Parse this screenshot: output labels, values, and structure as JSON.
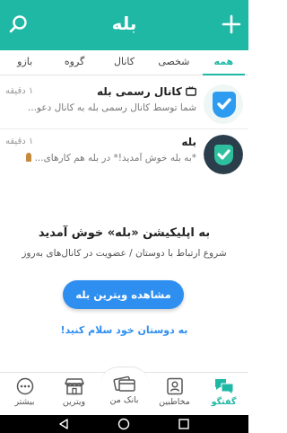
{
  "header": {
    "title": "بله",
    "search_icon": "search-icon",
    "add_icon": "plus-icon",
    "color": "#1fb8a5"
  },
  "tabs": [
    {
      "label": "همه",
      "active": true
    },
    {
      "label": "شخصی",
      "active": false
    },
    {
      "label": "کانال",
      "active": false
    },
    {
      "label": "گروه",
      "active": false
    },
    {
      "label": "بازو",
      "active": false
    }
  ],
  "chats": [
    {
      "name": "کانال رسمی بله",
      "time": "۱ دقیقه",
      "message": "شما توسط کانال رسمی بله به کانال دعو...",
      "icon": "tv-icon"
    },
    {
      "name": "بله",
      "time": "۱ دقیقه",
      "message": "*به بله خوش آمدید!* در بله هم کارهای..."
    }
  ],
  "welcome": {
    "title": "به اپلیکیشن «بله» خوش آمدید",
    "subtitle": "شروع ارتباط با دوستان / عضویت در کانال‌های به‌روز",
    "showcase_button": "مشاهده ویترین بله",
    "hello_link": "به دوستان خود سلام کنید!"
  },
  "bottom_nav": [
    {
      "label": "گفتگو",
      "icon": "chat-bubbles-icon",
      "active": true
    },
    {
      "label": "مخاطبین",
      "icon": "contacts-icon",
      "active": false
    },
    {
      "label": "بانک من",
      "icon": "bank-cards-icon",
      "active": false
    },
    {
      "label": "ویترین",
      "icon": "storefront-icon",
      "active": false
    },
    {
      "label": "بیشتر",
      "icon": "more-icon",
      "active": false
    }
  ],
  "colors": {
    "accent": "#1fb8a5",
    "link": "#2f8ff0"
  }
}
